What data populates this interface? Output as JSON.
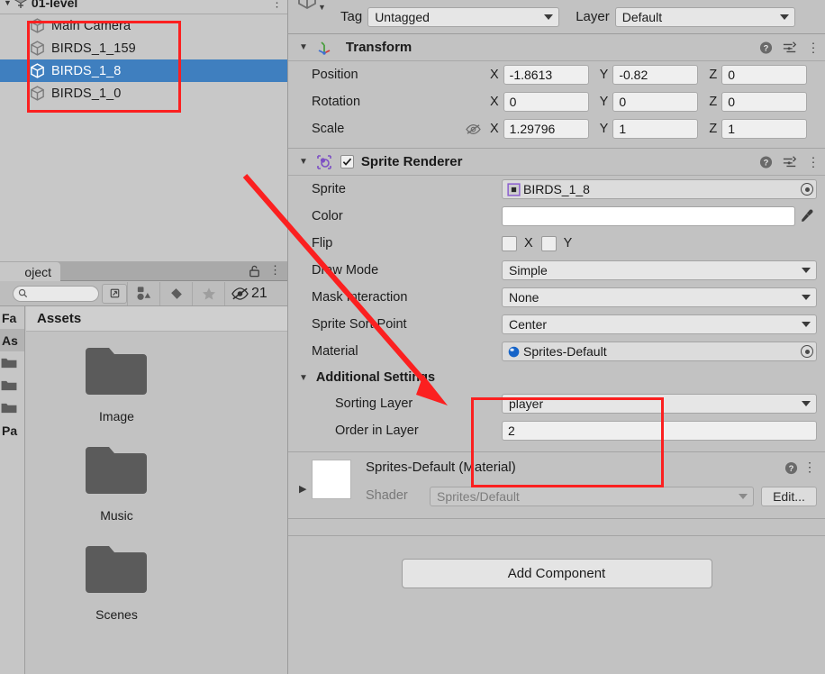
{
  "hierarchy": {
    "scene_name": "01-level",
    "items": [
      {
        "label": "Main Camera",
        "selected": false
      },
      {
        "label": "BIRDS_1_159",
        "selected": false
      },
      {
        "label": "BIRDS_1_8",
        "selected": true
      },
      {
        "label": "BIRDS_1_0",
        "selected": false
      }
    ]
  },
  "project": {
    "tab_label": "oject",
    "search_placeholder": "",
    "search_value": "",
    "hidden_count": "21",
    "assets_breadcrumb": "Assets",
    "tree": [
      {
        "label": "Fa",
        "type": "text",
        "selected": false
      },
      {
        "label": "As",
        "type": "text",
        "selected": true
      },
      {
        "label": "",
        "type": "folder",
        "selected": false
      },
      {
        "label": "",
        "type": "folder",
        "selected": false
      },
      {
        "label": "",
        "type": "folder",
        "selected": false
      },
      {
        "label": "Pa",
        "type": "text",
        "selected": false
      }
    ],
    "folders": [
      {
        "name": "Image"
      },
      {
        "name": "Music"
      },
      {
        "name": "Scenes"
      }
    ]
  },
  "inspector": {
    "tag_label": "Tag",
    "tag_value": "Untagged",
    "layer_label": "Layer",
    "layer_value": "Default",
    "transform": {
      "title": "Transform",
      "rows": [
        {
          "label": "Position",
          "x": "-1.8613",
          "y": "-0.82",
          "z": "0"
        },
        {
          "label": "Rotation",
          "x": "0",
          "y": "0",
          "z": "0"
        },
        {
          "label": "Scale",
          "x": "1.29796",
          "y": "1",
          "z": "1"
        }
      ],
      "axis_x": "X",
      "axis_y": "Y",
      "axis_z": "Z"
    },
    "sprite_renderer": {
      "title": "Sprite Renderer",
      "sprite_label": "Sprite",
      "sprite_value": "BIRDS_1_8",
      "color_label": "Color",
      "color_value": "#ffffff",
      "flip_label": "Flip",
      "flip_x_label": "X",
      "flip_y_label": "Y",
      "draw_mode_label": "Draw Mode",
      "draw_mode_value": "Simple",
      "mask_interaction_label": "Mask Interaction",
      "mask_interaction_value": "None",
      "sort_point_label": "Sprite Sort Point",
      "sort_point_value": "Center",
      "material_label": "Material",
      "material_value": "Sprites-Default",
      "additional_settings_label": "Additional Settings",
      "sorting_layer_label": "Sorting Layer",
      "sorting_layer_value": "player",
      "order_in_layer_label": "Order in Layer",
      "order_in_layer_value": "2"
    },
    "material_preview": {
      "title": "Sprites-Default (Material)",
      "shader_label": "Shader",
      "shader_value": "Sprites/Default",
      "edit_label": "Edit..."
    },
    "add_component_label": "Add Component"
  },
  "annotations": {
    "highlight_color": "#fb2020"
  }
}
